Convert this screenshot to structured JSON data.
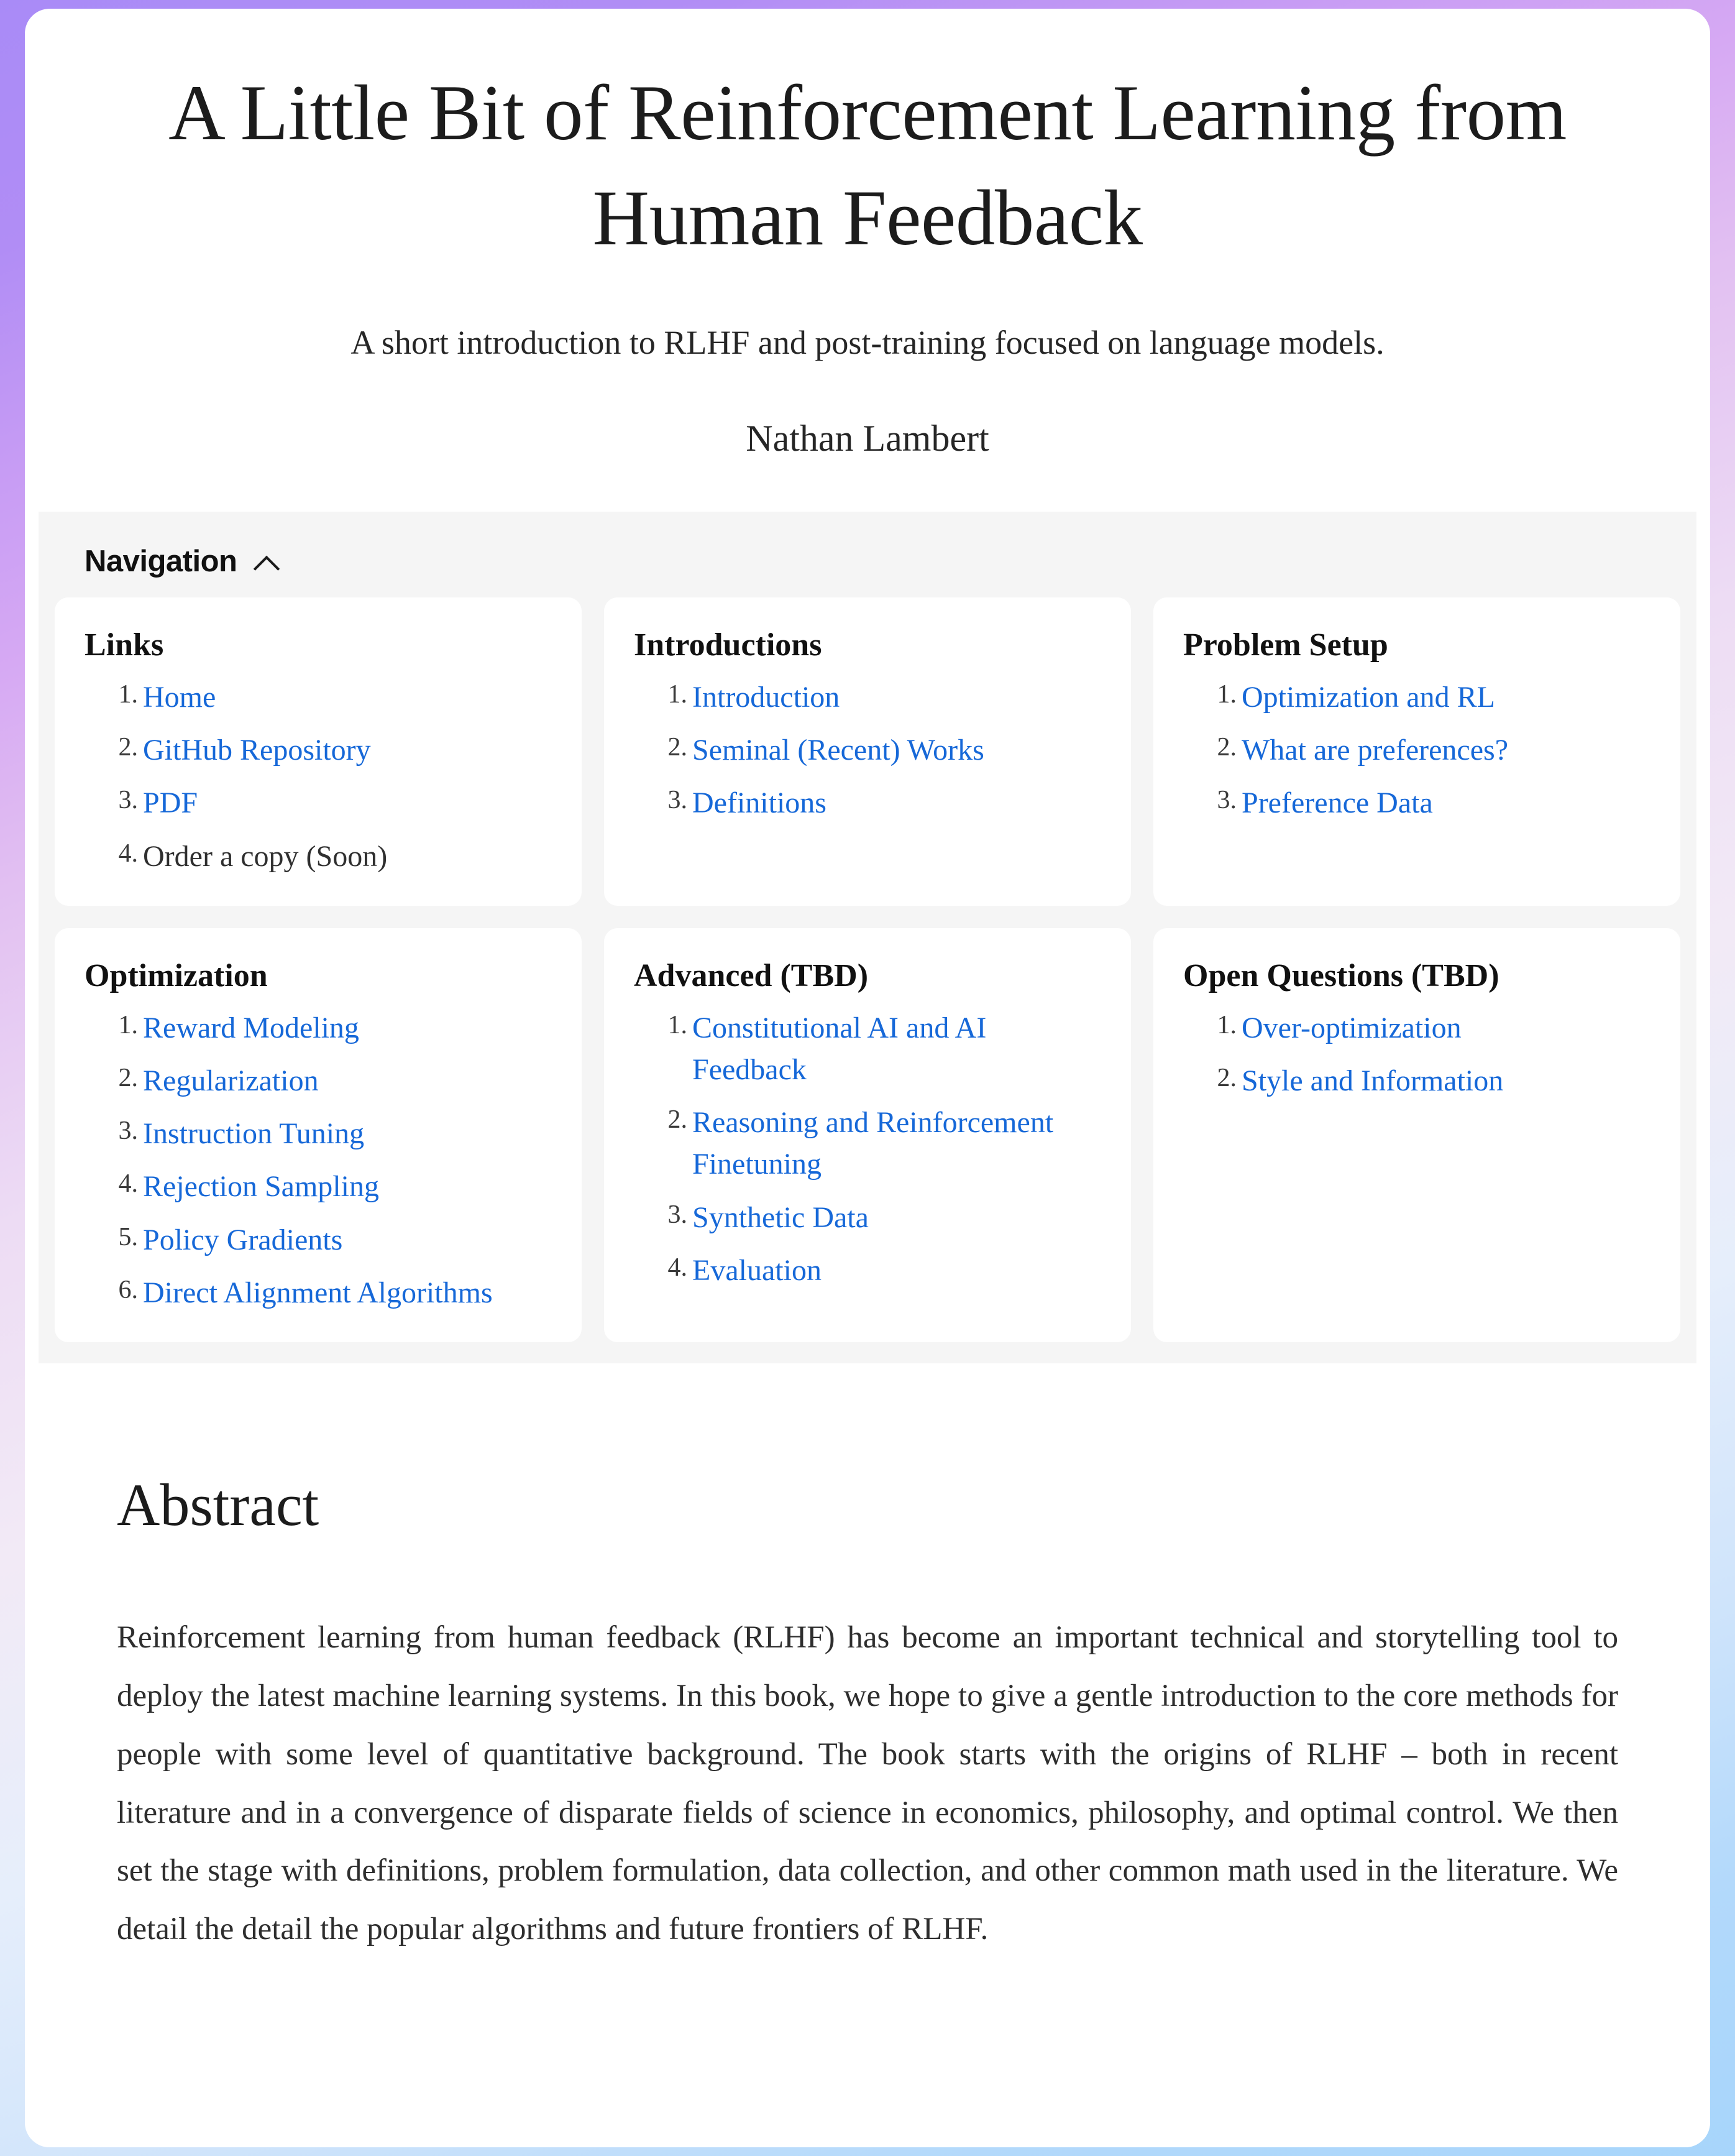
{
  "background": {
    "gradient_start": "#a98bf7",
    "gradient_end": "#a7d5fb"
  },
  "theme": {
    "link_color": "#1668d8",
    "text_color": "#2e2e2e",
    "nav_background": "#f5f5f5",
    "card_background": "#ffffff"
  },
  "masthead": {
    "title": "A Little Bit of Reinforcement Learning from Human Feedback",
    "subtitle": "A short introduction to RLHF and post-training focused on language models.",
    "author": "Nathan Lambert"
  },
  "navigation": {
    "header_label": "Navigation",
    "toggle_icon": "chevron-up-icon",
    "cards": [
      {
        "title": "Links",
        "items": [
          {
            "label": "Home",
            "is_link": true
          },
          {
            "label": "GitHub Repository",
            "is_link": true
          },
          {
            "label": "PDF",
            "is_link": true
          },
          {
            "label": "Order a copy (Soon)",
            "is_link": false
          }
        ]
      },
      {
        "title": "Introductions",
        "items": [
          {
            "label": "Introduction",
            "is_link": true
          },
          {
            "label": "Seminal (Recent) Works",
            "is_link": true
          },
          {
            "label": "Definitions",
            "is_link": true
          }
        ]
      },
      {
        "title": "Problem Setup",
        "items": [
          {
            "label": "Optimization and RL",
            "is_link": true
          },
          {
            "label": "What are preferences?",
            "is_link": true
          },
          {
            "label": "Preference Data",
            "is_link": true
          }
        ]
      },
      {
        "title": "Optimization",
        "items": [
          {
            "label": "Reward Modeling",
            "is_link": true
          },
          {
            "label": "Regularization",
            "is_link": true
          },
          {
            "label": "Instruction Tuning",
            "is_link": true
          },
          {
            "label": "Rejection Sampling",
            "is_link": true
          },
          {
            "label": "Policy Gradients",
            "is_link": true
          },
          {
            "label": "Direct Alignment Algorithms",
            "is_link": true
          }
        ]
      },
      {
        "title": "Advanced (TBD)",
        "items": [
          {
            "label": "Constitutional AI and AI Feedback",
            "is_link": true
          },
          {
            "label": "Reasoning and Reinforcement Finetuning",
            "is_link": true
          },
          {
            "label": "Synthetic Data",
            "is_link": true
          },
          {
            "label": "Evaluation",
            "is_link": true
          }
        ]
      },
      {
        "title": "Open Questions (TBD)",
        "items": [
          {
            "label": "Over-optimization",
            "is_link": true
          },
          {
            "label": "Style and Information",
            "is_link": true
          }
        ]
      }
    ]
  },
  "abstract": {
    "heading": "Abstract",
    "body": "Reinforcement learning from human feedback (RLHF) has become an important technical and storytelling tool to deploy the latest machine learning systems. In this book, we hope to give a gentle introduction to the core methods for people with some level of quantitative background. The book starts with the origins of RLHF – both in recent literature and in a convergence of disparate fields of science in economics, philosophy, and optimal control. We then set the stage with definitions, problem formulation, data collection, and other common math used in the literature. We detail the detail the popular algorithms and future frontiers of RLHF."
  }
}
